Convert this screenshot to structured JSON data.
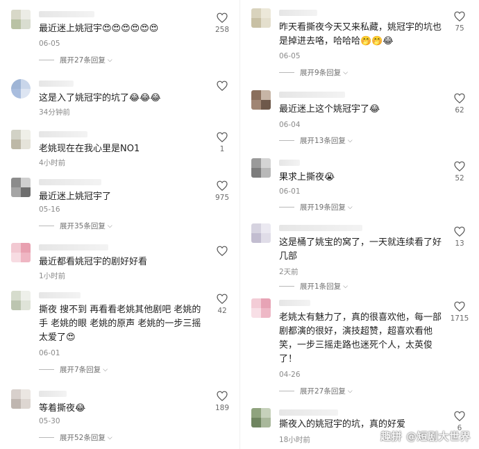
{
  "left_comments": [
    {
      "text": "最近迷上姚冠宇😍😍😍😍😍😍",
      "time": "06-05",
      "replies": "展开27条回复",
      "likes": "258"
    },
    {
      "text": "这是入了姚冠宇的坑了😂😂😂",
      "time": "34分钟前",
      "replies": "",
      "likes": ""
    },
    {
      "text": "老姚现在在我心里是NO1",
      "time": "4小时前",
      "replies": "",
      "likes": "1"
    },
    {
      "text": "最近迷上姚冠宇了",
      "time": "05-16",
      "replies": "展开35条回复",
      "likes": "975"
    },
    {
      "text": "最近都看姚冠宇的剧好好看",
      "time": "1小时前",
      "replies": "",
      "likes": ""
    },
    {
      "text": "撕夜 搜不到 再看看老姚其他剧吧 老姚的手 老姚的眼 老姚的原声 老姚的一步三摇太爱了😍",
      "time": "06-01",
      "replies": "展开7条回复",
      "likes": "42"
    },
    {
      "text": "等着撕夜😂",
      "time": "05-30",
      "replies": "展开52条回复",
      "likes": "189"
    }
  ],
  "right_comments": [
    {
      "text": "昨天看撕夜今天又来私藏，姚冠宇的坑也是掉进去咯，哈哈哈🤭🤭😂",
      "time": "06-05",
      "replies": "展开9条回复",
      "likes": "75"
    },
    {
      "text": "最近迷上这个姚冠宇了😂",
      "time": "06-04",
      "replies": "展开13条回复",
      "likes": "62"
    },
    {
      "text": "果求上撕夜😭",
      "time": "06-01",
      "replies": "展开19条回复",
      "likes": "52"
    },
    {
      "text": "这是桶了姚宝的窝了，一天就连续看了好几部",
      "time": "2天前",
      "replies": "展开1条回复",
      "likes": "13"
    },
    {
      "text": "老姚太有魅力了，真的很喜欢他，每一部剧都演的很好，演技超赞，超喜欢看他笑，一步三摇走路也迷死个人，太英俊了！",
      "time": "04-26",
      "replies": "展开27条回复",
      "likes": "1715"
    },
    {
      "text": "撕夜入的姚冠宇的坑，真的好爱",
      "time": "18小时前",
      "replies": "",
      "likes": "6"
    }
  ],
  "watermark": "@短剧大世界",
  "watermark_prefix": "趣拼"
}
